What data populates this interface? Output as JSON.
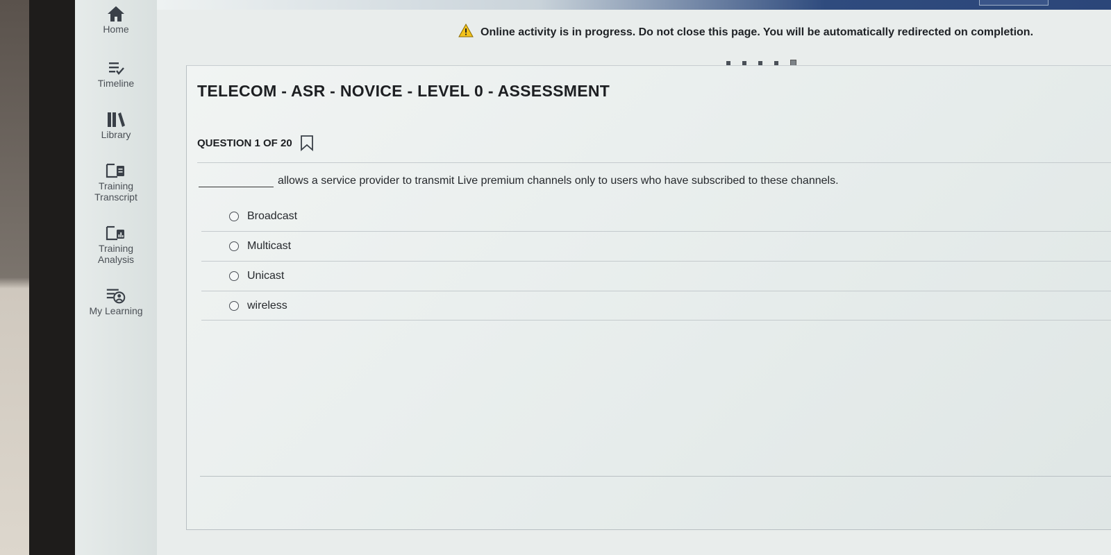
{
  "sidebar": {
    "items": [
      {
        "label_lines": [
          "Home"
        ],
        "icon": "home-icon"
      },
      {
        "label_lines": [
          "Timeline"
        ],
        "icon": "timeline-icon"
      },
      {
        "label_lines": [
          "Library"
        ],
        "icon": "library-icon"
      },
      {
        "label_lines": [
          "Training",
          "Transcript"
        ],
        "icon": "training-transcript-icon"
      },
      {
        "label_lines": [
          "Training",
          "Analysis"
        ],
        "icon": "training-analysis-icon"
      },
      {
        "label_lines": [
          "My Learning"
        ],
        "icon": "my-learning-icon"
      }
    ]
  },
  "banner": {
    "icon": "warning-icon",
    "text": "Online activity is in progress. Do not close this page. You will be automatically redirected on completion."
  },
  "progress": {
    "total_dots": 5,
    "current_index": 4
  },
  "assessment": {
    "title": "TELECOM - ASR - NOVICE - LEVEL 0 - ASSESSMENT",
    "question_counter": "QUESTION 1 OF 20",
    "bookmark_icon": "bookmark-icon",
    "prompt_text": "allows a service provider to transmit Live premium channels only to users who have subscribed to these channels.",
    "options": [
      {
        "label": "Broadcast",
        "selected": false
      },
      {
        "label": "Multicast",
        "selected": false
      },
      {
        "label": "Unicast",
        "selected": false
      },
      {
        "label": "wireless",
        "selected": false
      }
    ]
  },
  "colors": {
    "warning": "#f2c21b",
    "accent_bar": "#2b4679",
    "icon": "#3a4048"
  }
}
